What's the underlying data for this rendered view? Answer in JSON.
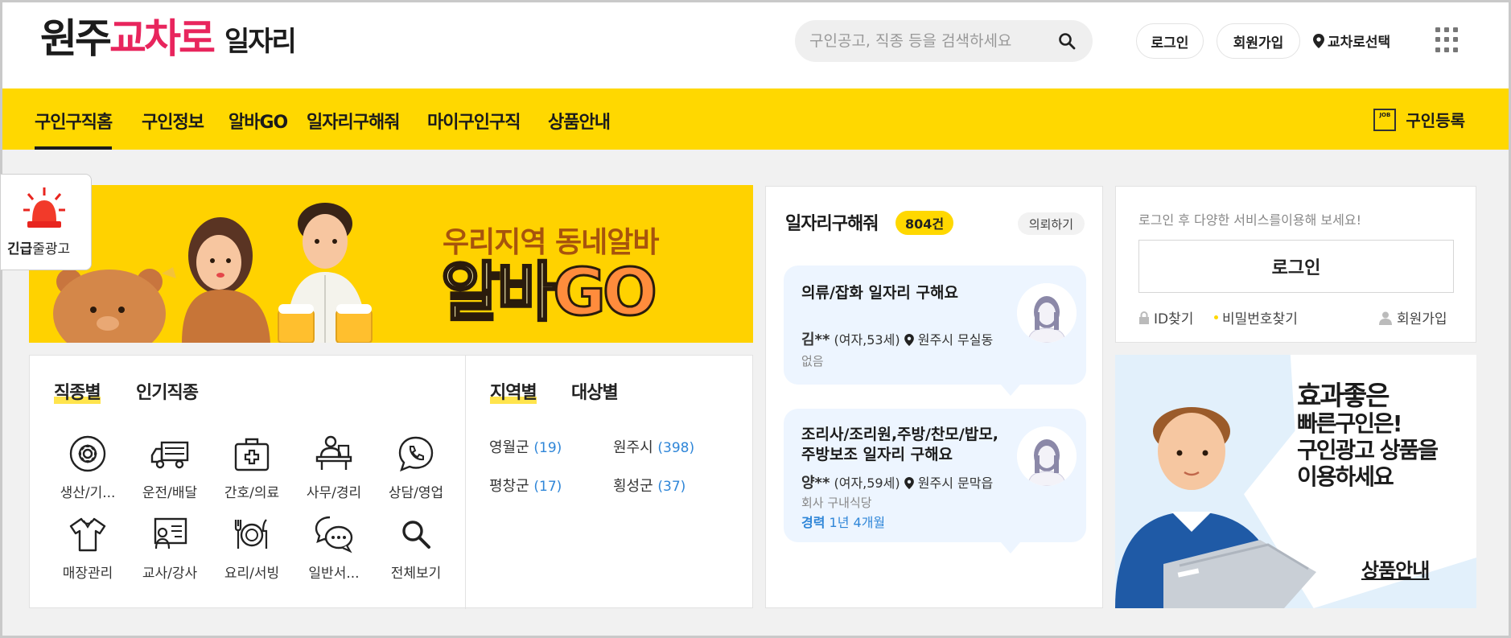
{
  "header": {
    "logo": {
      "city": "원주",
      "brand": "교차로",
      "suffix": "일자리"
    },
    "search_placeholder": "구인공고, 직종 등을 검색하세요",
    "login_label": "로그인",
    "signup_label": "회원가입",
    "location_label": "교차로선택"
  },
  "nav": {
    "items": [
      {
        "label": "구인구직홈"
      },
      {
        "label": "구인정보"
      },
      {
        "label": "알바GO"
      },
      {
        "label": "일자리구해줘"
      },
      {
        "label": "마이구인구직"
      },
      {
        "label": "상품안내"
      }
    ],
    "register_icon_text": "JOB",
    "register_label": "구인등록"
  },
  "urgent": {
    "bold": "긴급",
    "rest": "줄광고"
  },
  "banner": {
    "line1": "우리지역 동네알바",
    "line2_a": "알바",
    "line2_b": "GO"
  },
  "categories": {
    "tabs": [
      "직종별",
      "인기직종"
    ],
    "items": [
      {
        "label": "생산/기...",
        "icon": "gear-icon"
      },
      {
        "label": "운전/배달",
        "icon": "truck-icon"
      },
      {
        "label": "간호/의료",
        "icon": "medical-kit-icon"
      },
      {
        "label": "사무/경리",
        "icon": "office-desk-icon"
      },
      {
        "label": "상담/영업",
        "icon": "phone-chat-icon"
      },
      {
        "label": "매장관리",
        "icon": "shirt-icon"
      },
      {
        "label": "교사/강사",
        "icon": "teacher-board-icon"
      },
      {
        "label": "요리/서빙",
        "icon": "dish-icon"
      },
      {
        "label": "일반서...",
        "icon": "chat-bubbles-icon"
      },
      {
        "label": "전체보기",
        "icon": "search-icon"
      }
    ]
  },
  "regions": {
    "tabs": [
      "지역별",
      "대상별"
    ],
    "items": [
      {
        "name": "영월군",
        "count": "(19)"
      },
      {
        "name": "원주시",
        "count": "(398)"
      },
      {
        "name": "평창군",
        "count": "(17)"
      },
      {
        "name": "횡성군",
        "count": "(37)"
      }
    ]
  },
  "job_requests": {
    "title": "일자리구해줘",
    "count": "804건",
    "request_button": "의뢰하기",
    "cards": [
      {
        "title": "의류/잡화 일자리 구해요",
        "name": "김**",
        "info": "(여자,53세)",
        "location": "원주시 무실동",
        "detail": "없음"
      },
      {
        "title": "조리사/조리원,주방/찬모/밥모,주방보조 일자리 구해요",
        "name": "양**",
        "info": "(여자,59세)",
        "location": "원주시 문막읍",
        "detail": "회사 구내식당",
        "career_label": "경력",
        "career_value": "1년 4개월"
      }
    ]
  },
  "login_box": {
    "message": "로그인 후 다양한 서비스를이용해 보세요!",
    "button": "로그인",
    "find_id": "ID찾기",
    "find_pw": "비밀번호찾기",
    "signup": "회원가입"
  },
  "ad": {
    "line1": "효과좋은",
    "line2": "빠른구인은!",
    "line3": "구인광고 상품을",
    "line4": "이용하세요",
    "link": "상품안내"
  },
  "colors": {
    "accent": "#ffd800",
    "brand": "#e8255d",
    "link": "#2f86d8"
  }
}
